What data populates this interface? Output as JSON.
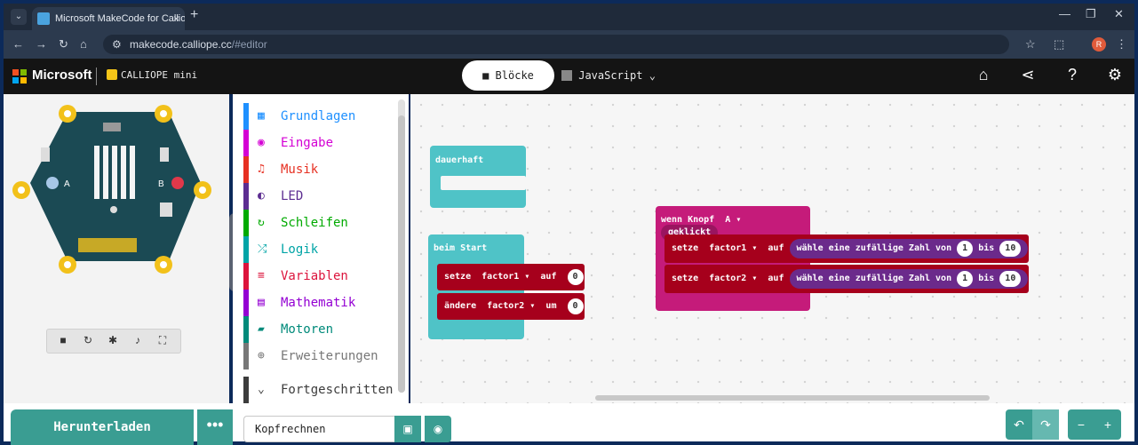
{
  "browser": {
    "tab_title": "Microsoft MakeCode for Calliop",
    "tab_close": "×",
    "new_tab": "+",
    "url_site": "makecode.calliope.cc",
    "url_path": "/#editor",
    "avatar_letter": "R"
  },
  "header": {
    "brand": "Microsoft",
    "product": "CALLIOPE mini",
    "tab_blocks": "Blöcke",
    "tab_js": "JavaScript"
  },
  "simulator": {
    "pin_labels": [
      "A",
      "B"
    ]
  },
  "toolbox": {
    "categories": [
      {
        "label": "Grundlagen",
        "color": "#1e90ff",
        "icon": "grid-icon"
      },
      {
        "label": "Eingabe",
        "color": "#d400d4",
        "icon": "circle-icon"
      },
      {
        "label": "Musik",
        "color": "#e63022",
        "icon": "headphones-icon"
      },
      {
        "label": "LED",
        "color": "#5c2d91",
        "icon": "toggle-icon"
      },
      {
        "label": "Schleifen",
        "color": "#00aa00",
        "icon": "refresh-icon"
      },
      {
        "label": "Logik",
        "color": "#00a4a6",
        "icon": "shuffle-icon"
      },
      {
        "label": "Variablen",
        "color": "#dc143c",
        "icon": "list-icon"
      },
      {
        "label": "Mathematik",
        "color": "#9400d3",
        "icon": "calculator-icon"
      },
      {
        "label": "Motoren",
        "color": "#008a7a",
        "icon": "car-icon"
      },
      {
        "label": "Erweiterungen",
        "color": "#777777",
        "icon": "plus-icon"
      },
      {
        "label": "Fortgeschritten",
        "color": "#3c3c3c",
        "icon": "chevron-down-icon"
      }
    ]
  },
  "blocks": {
    "forever_label": "dauerhaft",
    "start_label": "beim Start",
    "set_label": "setze",
    "var1": "factor1",
    "var2": "factor2",
    "to_label": "auf",
    "zero": "0",
    "change_label": "ändere",
    "by_label": "um",
    "on_button_label": "wenn Knopf",
    "button_value": "A",
    "pressed_label": "geklickt",
    "random_label": "wähle eine zufällige Zahl von",
    "from_value": "1",
    "until_label": "bis",
    "to_value": "10"
  },
  "bottom": {
    "download_label": "Herunterladen",
    "more_label": "•••",
    "project_name": "Kopfrechnen"
  },
  "colors": {
    "accent": "#3a9d92",
    "loops": "#4fc3c7",
    "variables": "#a6001c",
    "input": "#c51b7a",
    "math": "#6b2a8b"
  }
}
